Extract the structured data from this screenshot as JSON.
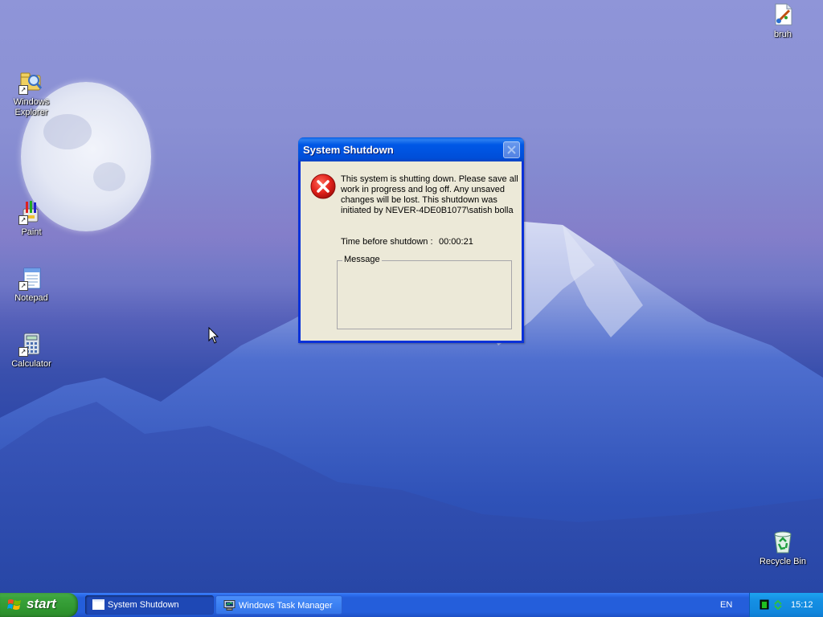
{
  "desktop": {
    "icons": [
      {
        "label": "Windows Explorer",
        "icon": "windows-explorer-icon"
      },
      {
        "label": "Paint",
        "icon": "paint-icon"
      },
      {
        "label": "Notepad",
        "icon": "notepad-icon"
      },
      {
        "label": "Calculator",
        "icon": "calculator-icon"
      },
      {
        "label": "bruh",
        "icon": "paint-file-icon"
      },
      {
        "label": "Recycle Bin",
        "icon": "recycle-bin-icon"
      }
    ]
  },
  "dialog": {
    "title": "System Shutdown",
    "close_icon": "close-icon",
    "icon": "error-icon",
    "message": "This system is shutting down. Please save all work in progress and log off. Any unsaved changes will be lost. This shutdown was initiated by NEVER-4DE0B1077\\satish bolla",
    "time_label": "Time before shutdown :",
    "time_value": "00:00:21",
    "message_group_label": "Message",
    "message_text": ""
  },
  "taskbar": {
    "start_label": "start",
    "tasks": [
      {
        "label": "System Shutdown",
        "active": true
      },
      {
        "label": "Windows Task Manager",
        "active": false
      }
    ],
    "language": "EN",
    "clock": "15:12"
  },
  "colors": {
    "titlebar": "#0058e6",
    "dialog_bg": "#ece9d8",
    "taskbar": "#245edb",
    "start_button": "#3aa33c",
    "tray": "#1590e4"
  }
}
